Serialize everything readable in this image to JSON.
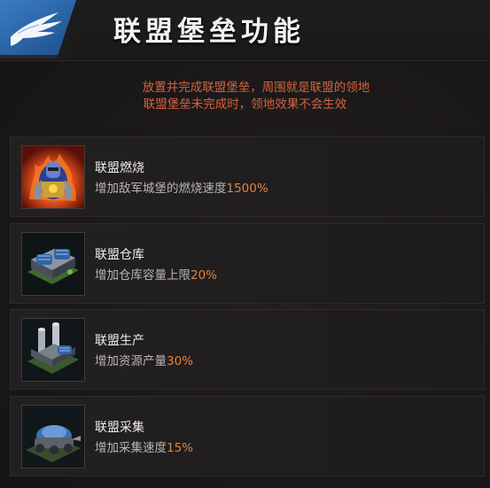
{
  "header": {
    "title": "联盟堡垒功能",
    "emblem_icon": "eagle-wing-icon"
  },
  "description": {
    "line1": "放置并完成联盟堡垒，周围就是联盟的领地",
    "line2": "联盟堡垒未完成时，领地效果不会生效"
  },
  "colors": {
    "accent_orange": "#e0853b",
    "description_red": "#d4643d",
    "title_white": "#f4f2ef",
    "emblem_blue": "#2f6fb4"
  },
  "features": [
    {
      "name": "联盟燃烧",
      "desc_prefix": "增加敌军城堡的燃烧速度",
      "value": "1500%",
      "icon": "burning-knight-icon"
    },
    {
      "name": "联盟仓库",
      "desc_prefix": "增加仓库容量上限",
      "value": "20%",
      "icon": "warehouse-building-icon"
    },
    {
      "name": "联盟生产",
      "desc_prefix": "增加资源产量",
      "value": "30%",
      "icon": "production-factory-icon"
    },
    {
      "name": "联盟采集",
      "desc_prefix": "增加采集速度",
      "value": "15%",
      "icon": "gathering-vehicle-icon"
    }
  ]
}
